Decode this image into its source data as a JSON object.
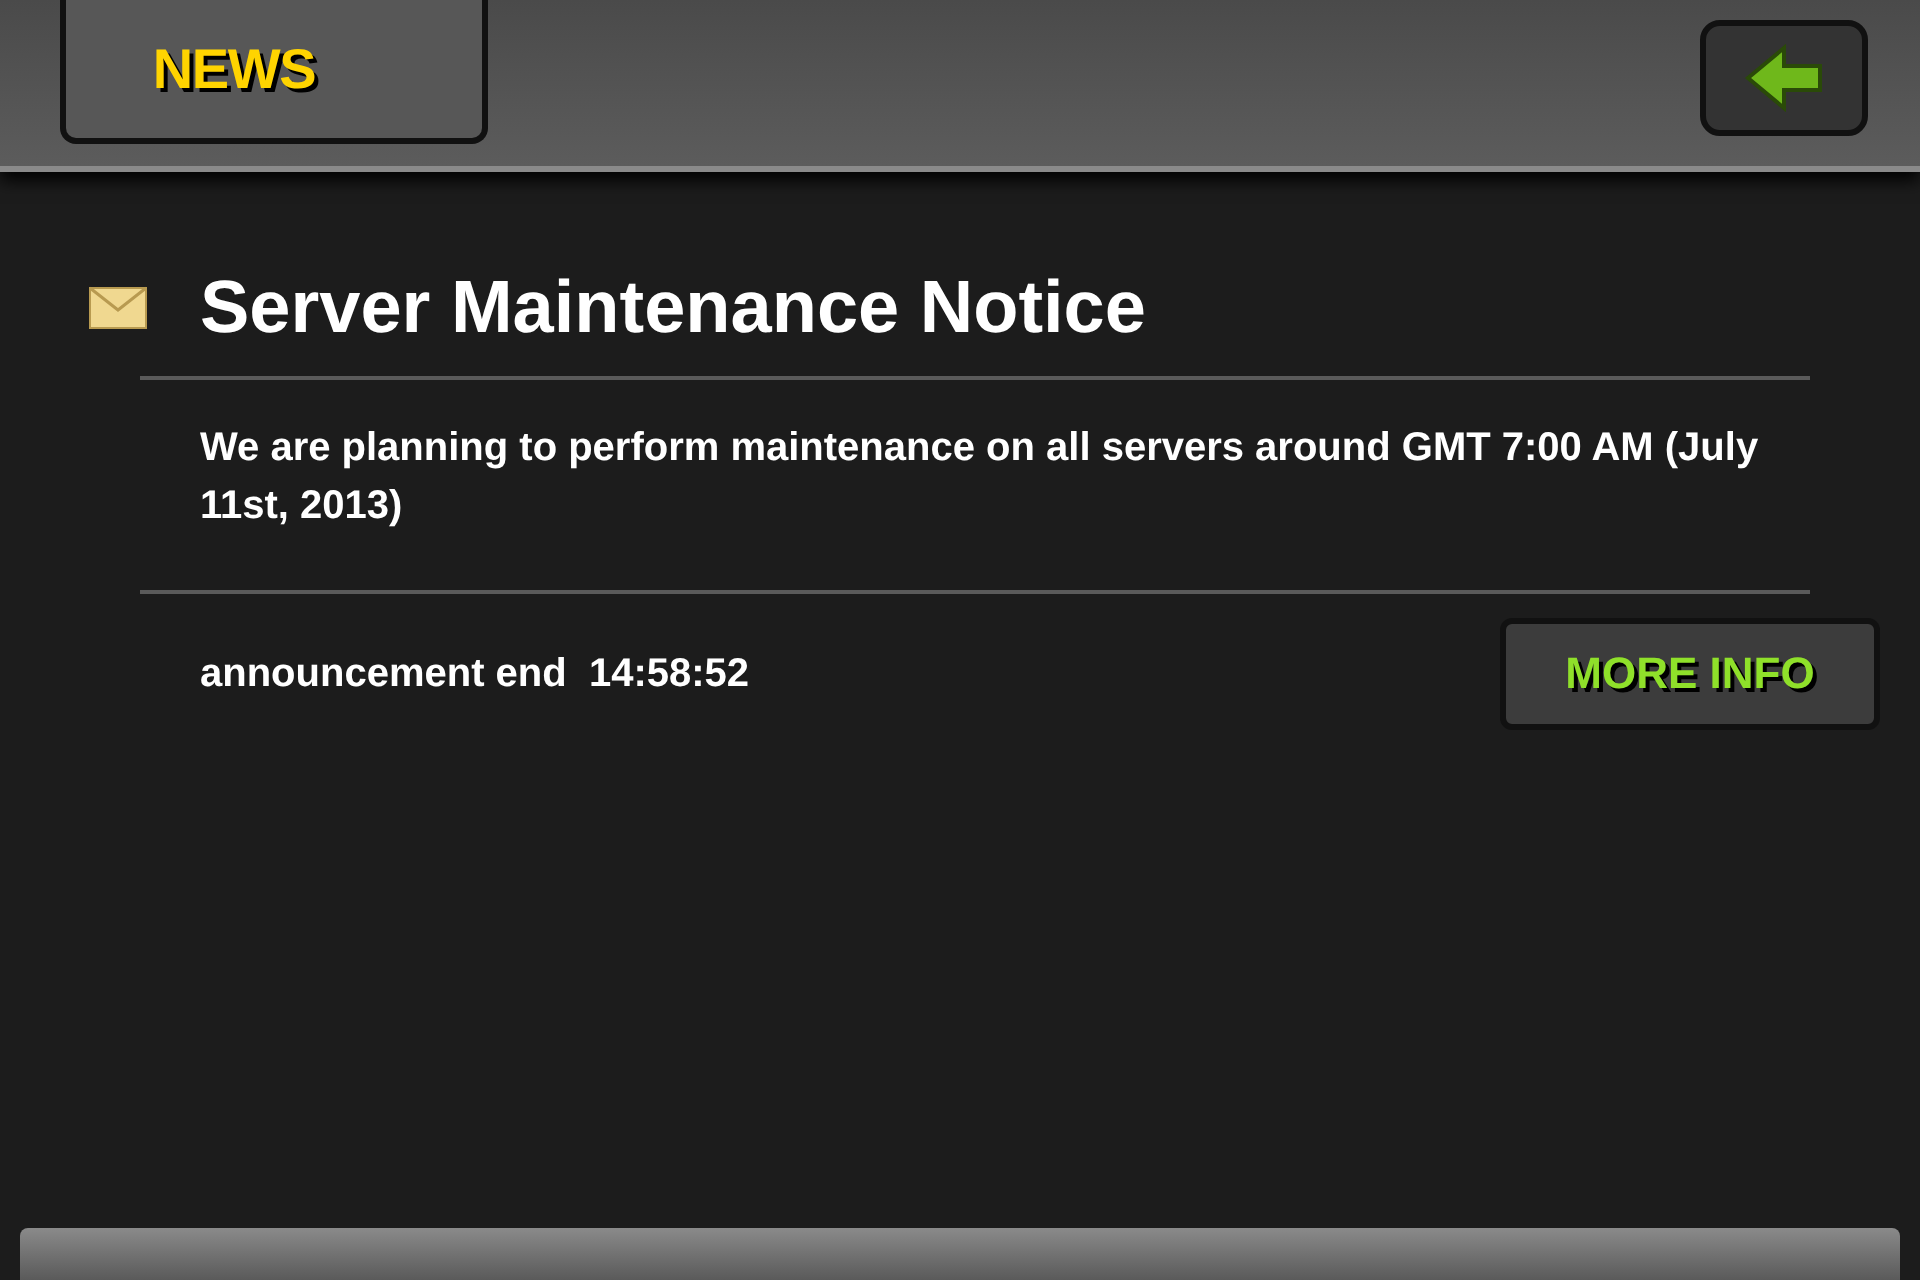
{
  "header": {
    "title": "NEWS"
  },
  "notice": {
    "title": "Server Maintenance Notice",
    "body": "We are planning to perform maintenance on all servers around GMT 7:00 AM (July 11st, 2013)",
    "end_label": "announcement end  14:58:52",
    "button": "MORE INFO"
  }
}
